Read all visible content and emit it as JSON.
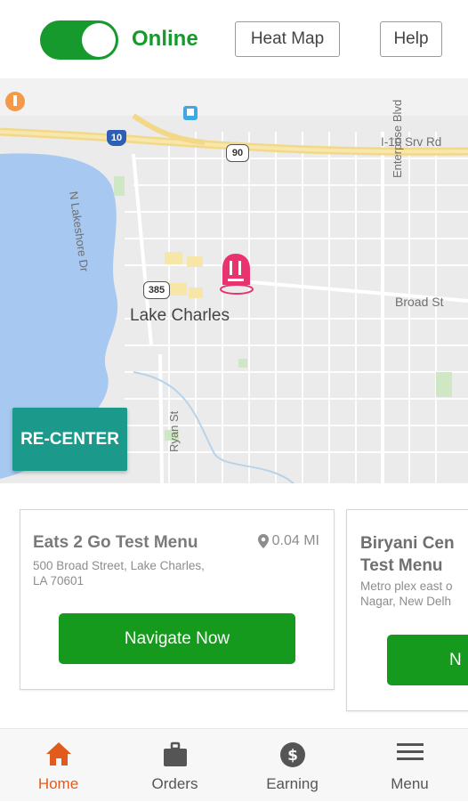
{
  "header": {
    "status_label": "Online",
    "online": true,
    "heat_map_label": "Heat Map",
    "help_label": "Help",
    "accent_color": "#169a2d"
  },
  "map": {
    "labels": {
      "lake_charles": "Lake Charles",
      "n_lakeshore": "N Lakeshore Dr",
      "i10_srv": "I-10 Srv Rd",
      "enterprise": "Enterprise Blvd",
      "broad_st": "Broad St",
      "ryan_st": "Ryan St",
      "shield_10": "10",
      "shield_90": "90",
      "shield_385": "385"
    },
    "recenter_label": "RE-CENTER"
  },
  "cards": [
    {
      "title": "Eats 2 Go Test Menu",
      "address_line1": "500 Broad Street, Lake Charles,",
      "address_line2": "LA 70601",
      "distance": "0.04 MI",
      "button_label": "Navigate Now"
    },
    {
      "title_line1": "Biryani Cen",
      "title_line2": "Test Menu",
      "address_line1": "Metro plex east o",
      "address_line2": "Nagar, New Delh",
      "button_label": "N"
    }
  ],
  "bottom_nav": [
    {
      "label": "Home",
      "icon": "home-icon",
      "active": true
    },
    {
      "label": "Orders",
      "icon": "bag-icon",
      "active": false
    },
    {
      "label": "Earning",
      "icon": "dollar-icon",
      "active": false
    },
    {
      "label": "Menu",
      "icon": "hamburger-icon",
      "active": false
    }
  ],
  "colors": {
    "active_nav": "#e35b1c",
    "recenter": "#1b9a8c",
    "navigate_button": "#169a1e",
    "marker": "#e8336f"
  }
}
